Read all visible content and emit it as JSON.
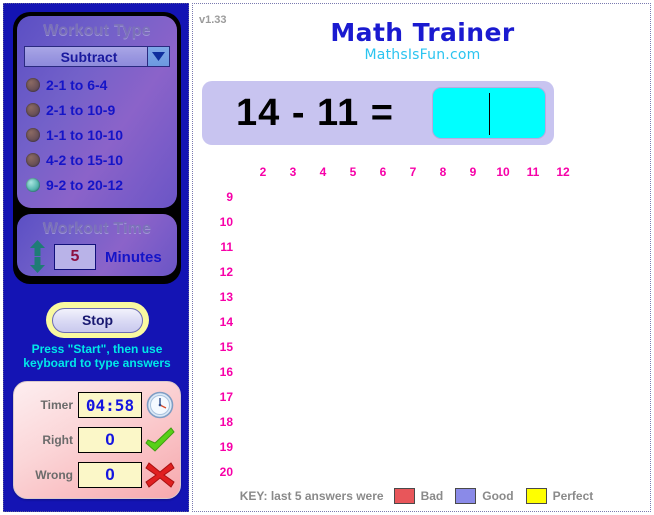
{
  "app": {
    "version": "v1.33",
    "title": "Math Trainer",
    "subtitle": "MathsIsFun.com"
  },
  "workout_type": {
    "panel_title": "Workout Type",
    "selected_operation": "Subtract",
    "dropdown_icon": "chevron-down-icon",
    "options": [
      {
        "label": "2-1 to 6-4",
        "selected": false
      },
      {
        "label": "2-1 to 10-9",
        "selected": false
      },
      {
        "label": "1-1 to 10-10",
        "selected": false
      },
      {
        "label": "4-2 to 15-10",
        "selected": false
      },
      {
        "label": "9-2 to 20-12",
        "selected": true
      }
    ]
  },
  "workout_time": {
    "panel_title": "Workout Time",
    "value": "5",
    "unit": "Minutes",
    "up_icon": "arrow-up-icon",
    "down_icon": "arrow-down-icon"
  },
  "controls": {
    "stop_label": "Stop",
    "hint_line1": "Press \"Start\", then use",
    "hint_line2": "keyboard to type answers"
  },
  "score": {
    "timer_label": "Timer",
    "timer_value": "04:58",
    "timer_icon": "clock-icon",
    "right_label": "Right",
    "right_value": "0",
    "right_icon": "check-icon",
    "wrong_label": "Wrong",
    "wrong_value": "0",
    "wrong_icon": "cross-icon"
  },
  "question": {
    "expression": "14 - 11 =",
    "answer_value": "",
    "answer_bg": "#00ffff"
  },
  "grid": {
    "columns": [
      "2",
      "3",
      "4",
      "5",
      "6",
      "7",
      "8",
      "9",
      "10",
      "11",
      "12"
    ],
    "rows": [
      "9",
      "10",
      "11",
      "12",
      "13",
      "14",
      "15",
      "16",
      "17",
      "18",
      "19",
      "20"
    ],
    "label_color": "#f700a8"
  },
  "key": {
    "label": "KEY:  last 5 answers were",
    "items": [
      {
        "text": "Bad",
        "color": "#e8565a"
      },
      {
        "text": "Good",
        "color": "#8a8ae8"
      },
      {
        "text": "Perfect",
        "color": "#ffff00"
      }
    ]
  }
}
